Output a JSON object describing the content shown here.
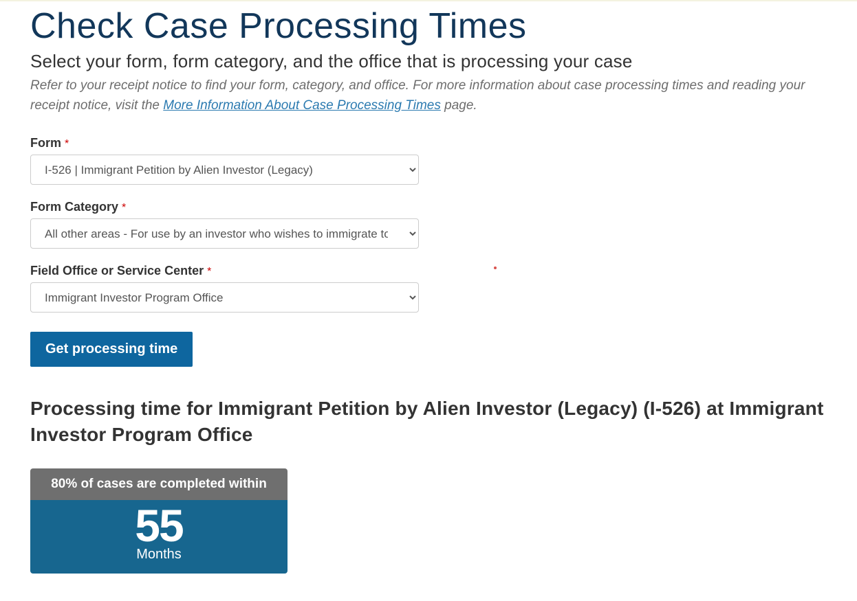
{
  "title": "Check Case Processing Times",
  "subtitle": "Select your form, form category, and the office that is processing your case",
  "helper_prefix": "Refer to your receipt notice to find your form, category, and office. For more information about case processing times and reading your receipt notice, visit the ",
  "helper_link": "More Information About Case Processing Times",
  "helper_suffix": " page.",
  "fields": {
    "form": {
      "label": "Form",
      "value": "I-526 | Immigrant Petition by Alien Investor (Legacy)"
    },
    "category": {
      "label": "Form Category",
      "value": "All other areas - For use by an investor who wishes to immigrate to"
    },
    "office": {
      "label": "Field Office or Service Center",
      "value": "Immigrant Investor Program Office"
    }
  },
  "submit_label": "Get processing time",
  "result": {
    "heading": "Processing time for Immigrant Petition by Alien Investor (Legacy) (I-526) at Immigrant Investor Program Office",
    "card_head": "80% of cases are completed within",
    "number": "55",
    "unit": "Months"
  }
}
